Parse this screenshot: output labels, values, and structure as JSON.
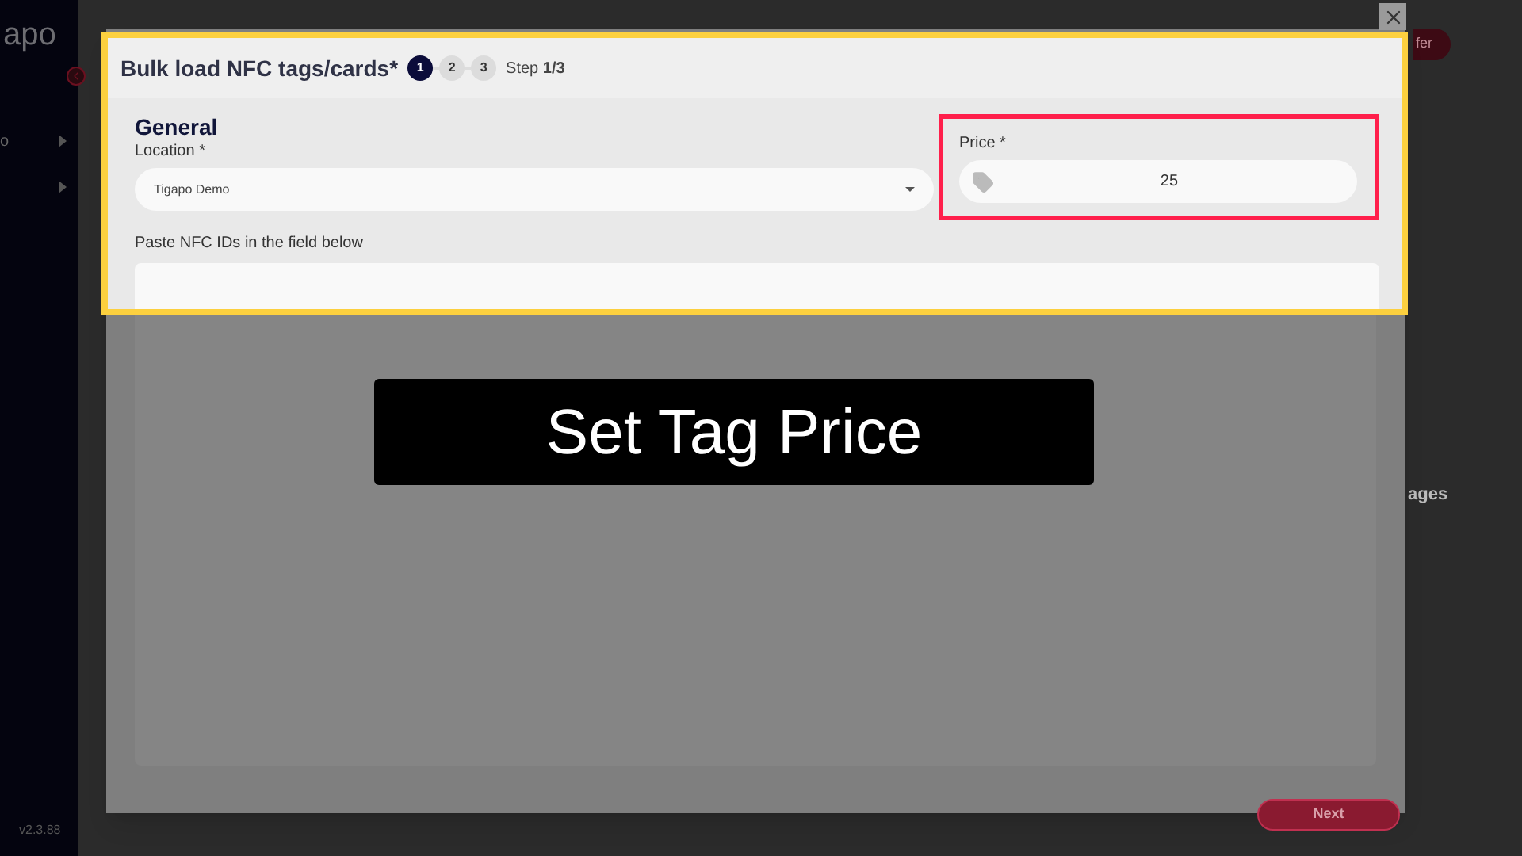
{
  "sidebar": {
    "logo": "apo",
    "items": [
      {
        "label": "o",
        "expandable": true
      },
      {
        "expandable": true
      }
    ],
    "version": "v2.3.88"
  },
  "background": {
    "top_button": "fer",
    "section_title": "ages"
  },
  "modal": {
    "title": "Bulk load NFC tags/cards*",
    "steps": [
      {
        "label": "1",
        "selected": true
      },
      {
        "label": "2",
        "selected": false
      },
      {
        "label": "3",
        "selected": false
      }
    ],
    "step_text": "Step **1/3**",
    "section": "General",
    "location": {
      "label": "Location *",
      "value": "Tigapo Demo"
    },
    "price": {
      "label": "Price *",
      "value": "25"
    },
    "ids": {
      "label": "Paste NFC IDs in the field below"
    },
    "next": "Next"
  },
  "caption": "Set Tag Price"
}
